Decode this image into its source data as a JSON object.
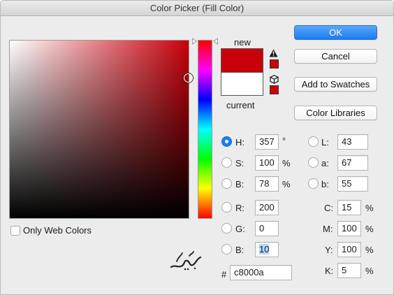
{
  "window": {
    "title": "Color Picker (Fill Color)"
  },
  "preview": {
    "new_label": "new",
    "current_label": "current",
    "new_color": "#c8000a",
    "current_color": "#ffffff",
    "gamut_warning_color": "#c8000a",
    "web_safe_color": "#cc0000"
  },
  "buttons": {
    "ok": "OK",
    "cancel": "Cancel",
    "add_to_swatches": "Add to Swatches",
    "color_libraries": "Color Libraries"
  },
  "hsb": {
    "h": {
      "label": "H:",
      "value": "357",
      "unit": "°"
    },
    "s": {
      "label": "S:",
      "value": "100",
      "unit": "%"
    },
    "b": {
      "label": "B:",
      "value": "78",
      "unit": "%"
    }
  },
  "rgb": {
    "r": {
      "label": "R:",
      "value": "200"
    },
    "g": {
      "label": "G:",
      "value": "0"
    },
    "b": {
      "label": "B:",
      "value": "10"
    }
  },
  "lab": {
    "l": {
      "label": "L:",
      "value": "43"
    },
    "a": {
      "label": "a:",
      "value": "67"
    },
    "b": {
      "label": "b:",
      "value": "55"
    }
  },
  "cmyk": {
    "c": {
      "label": "C:",
      "value": "15",
      "unit": "%"
    },
    "m": {
      "label": "M:",
      "value": "100",
      "unit": "%"
    },
    "y": {
      "label": "Y:",
      "value": "100",
      "unit": "%"
    },
    "k": {
      "label": "K:",
      "value": "5",
      "unit": "%"
    }
  },
  "hex": {
    "label": "#",
    "value": "c8000a"
  },
  "options": {
    "only_web_colors": "Only Web Colors"
  },
  "selected_channel": "H"
}
